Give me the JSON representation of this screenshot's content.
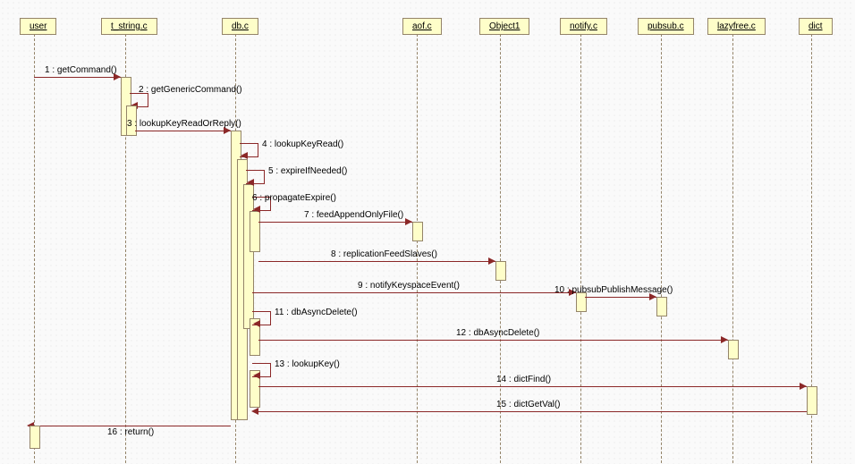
{
  "participants": {
    "user": "user",
    "t_string": "t_string.c",
    "db": "db.c",
    "aof": "aof.c",
    "object1": "Object1",
    "notify": "notify.c",
    "pubsub": "pubsub.c",
    "lazyfree": "lazyfree.c",
    "dict": "dict"
  },
  "messages": {
    "m1": "1 : getCommand()",
    "m2": "2 : getGenericCommand()",
    "m3": "3 : lookupKeyReadOrReply()",
    "m4": "4 : lookupKeyRead()",
    "m5": "5 : expireIfNeeded()",
    "m6": "6 : propagateExpire()",
    "m7": "7 : feedAppendOnlyFile()",
    "m8": "8 : replicationFeedSlaves()",
    "m9": "9 : notifyKeyspaceEvent()",
    "m10": "10 : pubsubPublishMessage()",
    "m11": "11 : dbAsyncDelete()",
    "m12": "12 : dbAsyncDelete()",
    "m13": "13 : lookupKey()",
    "m14": "14 : dictFind()",
    "m15": "15 : dictGetVal()",
    "m16": "16 : return()"
  }
}
